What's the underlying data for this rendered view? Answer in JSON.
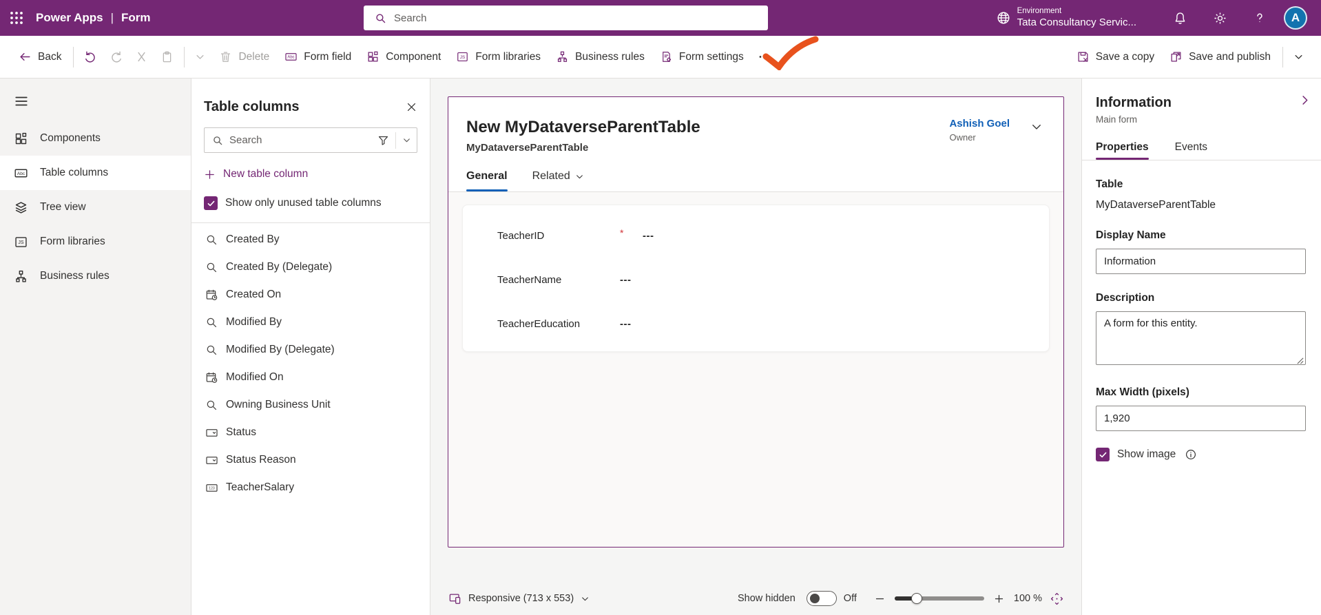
{
  "header": {
    "app_title": "Power Apps",
    "separator": "|",
    "page_title": "Form",
    "search_placeholder": "Search",
    "environment_label": "Environment",
    "environment_name": "Tata Consultancy Servic...",
    "avatar_initial": "A"
  },
  "toolbar": {
    "back_label": "Back",
    "delete_label": "Delete",
    "form_field_label": "Form field",
    "component_label": "Component",
    "form_libraries_label": "Form libraries",
    "business_rules_label": "Business rules",
    "form_settings_label": "Form settings",
    "save_a_copy_label": "Save a copy",
    "save_and_publish_label": "Save and publish"
  },
  "sidebar": {
    "items": [
      {
        "label": "Components",
        "icon": "components",
        "selected": false
      },
      {
        "label": "Table columns",
        "icon": "abc",
        "selected": true
      },
      {
        "label": "Tree view",
        "icon": "layers",
        "selected": false
      },
      {
        "label": "Form libraries",
        "icon": "js",
        "selected": false
      },
      {
        "label": "Business rules",
        "icon": "rules",
        "selected": false
      }
    ]
  },
  "columns_panel": {
    "title": "Table columns",
    "search_placeholder": "Search",
    "new_column_label": "New table column",
    "checkbox_label": "Show only unused table columns",
    "items": [
      {
        "label": "Created By",
        "icon": "lookup"
      },
      {
        "label": "Created By (Delegate)",
        "icon": "lookup"
      },
      {
        "label": "Created On",
        "icon": "datetime"
      },
      {
        "label": "Modified By",
        "icon": "lookup"
      },
      {
        "label": "Modified By (Delegate)",
        "icon": "lookup"
      },
      {
        "label": "Modified On",
        "icon": "datetime"
      },
      {
        "label": "Owning Business Unit",
        "icon": "lookup"
      },
      {
        "label": "Status",
        "icon": "choice"
      },
      {
        "label": "Status Reason",
        "icon": "choice"
      },
      {
        "label": "TeacherSalary",
        "icon": "number"
      }
    ]
  },
  "canvas": {
    "form_title": "New MyDataverseParentTable",
    "form_subtitle": "MyDataverseParentTable",
    "owner_name": "Ashish Goel",
    "owner_role": "Owner",
    "tabs": [
      {
        "label": "General"
      },
      {
        "label": "Related"
      }
    ],
    "required_marker": "*",
    "fields": [
      {
        "label": "TeacherID",
        "required": true,
        "value": "---"
      },
      {
        "label": "TeacherName",
        "required": false,
        "value": "---"
      },
      {
        "label": "TeacherEducation",
        "required": false,
        "value": "---"
      }
    ]
  },
  "properties_panel": {
    "title": "Information",
    "subtitle": "Main form",
    "tabs": [
      {
        "label": "Properties"
      },
      {
        "label": "Events"
      }
    ],
    "table_label": "Table",
    "table_value": "MyDataverseParentTable",
    "display_name_label": "Display Name",
    "display_name_value": "Information",
    "description_label": "Description",
    "description_value": "A form for this entity.",
    "max_width_label": "Max Width (pixels)",
    "max_width_value": "1,920",
    "show_image_label": "Show image"
  },
  "footer": {
    "responsive_label": "Responsive (713 x 553)",
    "show_hidden_label": "Show hidden",
    "toggle_state": "Off",
    "zoom_value": "100 %"
  },
  "colors": {
    "header_purple": "#742774",
    "accent_purple": "#742774",
    "link_blue": "#1160b7",
    "tab_underline_blue": "#1160b7",
    "required_red": "#d13438",
    "annotation_orange": "#e8521d",
    "avatar_blue": "#1273af"
  }
}
